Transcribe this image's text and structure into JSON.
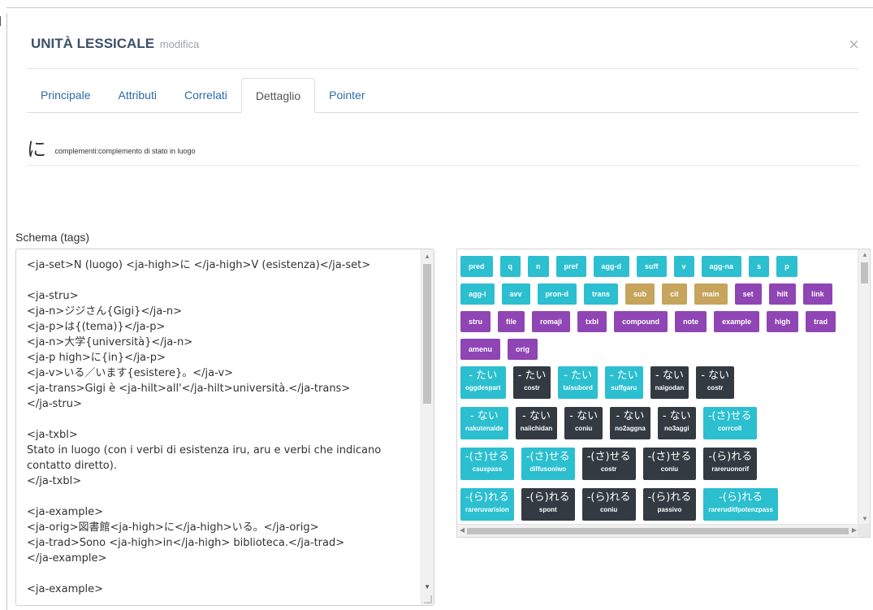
{
  "modal": {
    "title": "UNITÀ LESSICALE",
    "subtitle": "modifica",
    "close": "×"
  },
  "tabs": [
    {
      "label": "Principale"
    },
    {
      "label": "Attributi"
    },
    {
      "label": "Correlati"
    },
    {
      "label": "Dettaglio",
      "active": true
    },
    {
      "label": "Pointer"
    }
  ],
  "detail": {
    "char": "に",
    "description": "complementi:complemento di stato in luogo"
  },
  "schema": {
    "label": "Schema (tags)",
    "lines": [
      "<ja-set>N (luogo) <ja-high>に </ja-high>V (esistenza)</ja-set>",
      "",
      "<ja-stru>",
      "<ja-n>ジジさん{Gigi}</ja-n>",
      "<ja-p>は{(tema)}</ja-p>",
      "<ja-n>大学{università}</ja-n>",
      "<ja-p high>に{in}</ja-p>",
      "<ja-v>いる／います{esistere}。</ja-v>",
      "<ja-trans>Gigi è <ja-hilt>all'</ja-hilt>università.</ja-trans>",
      "</ja-stru>",
      "",
      "<ja-txbl>",
      "Stato in luogo (con i verbi di esistenza iru, aru e verbi che indicano",
      "contatto diretto).",
      "</ja-txbl>",
      "",
      "<ja-example>",
      "<ja-orig>図書館<ja-high>に</ja-high>いる。</ja-orig>",
      "<ja-trad>Sono <ja-high>in</ja-high> biblioteca.</ja-trad>",
      "</ja-example>",
      "",
      "<ja-example>"
    ]
  },
  "tags": {
    "row1": [
      {
        "label": "pred",
        "color": "teal"
      },
      {
        "label": "q",
        "color": "teal"
      },
      {
        "label": "n",
        "color": "teal"
      },
      {
        "label": "pref",
        "color": "teal"
      },
      {
        "label": "agg-d",
        "color": "teal"
      },
      {
        "label": "suff",
        "color": "teal"
      },
      {
        "label": "v",
        "color": "teal"
      },
      {
        "label": "agg-na",
        "color": "teal"
      },
      {
        "label": "s",
        "color": "teal"
      },
      {
        "label": "p",
        "color": "teal"
      }
    ],
    "row2": [
      {
        "label": "agg-i",
        "color": "teal"
      },
      {
        "label": "avv",
        "color": "teal"
      },
      {
        "label": "pron-d",
        "color": "teal"
      },
      {
        "label": "trans",
        "color": "teal"
      },
      {
        "label": "sub",
        "color": "gold"
      },
      {
        "label": "cit",
        "color": "gold"
      },
      {
        "label": "main",
        "color": "gold"
      },
      {
        "label": "set",
        "color": "purple"
      },
      {
        "label": "hilt",
        "color": "purple"
      },
      {
        "label": "link",
        "color": "purple"
      }
    ],
    "row3": [
      {
        "label": "stru",
        "color": "purple"
      },
      {
        "label": "file",
        "color": "purple"
      },
      {
        "label": "romaji",
        "color": "purple"
      },
      {
        "label": "txbl",
        "color": "purple"
      },
      {
        "label": "compound",
        "color": "purple"
      },
      {
        "label": "note",
        "color": "purple"
      },
      {
        "label": "example",
        "color": "purple"
      },
      {
        "label": "high",
        "color": "purple"
      },
      {
        "label": "trad",
        "color": "purple"
      }
    ],
    "row4": [
      {
        "label": "amenu",
        "color": "purple"
      },
      {
        "label": "orig",
        "color": "purple"
      }
    ]
  },
  "forms": {
    "row1": [
      {
        "jp": "- たい",
        "name": "oggdespart",
        "color": "teal"
      },
      {
        "jp": "- たい",
        "name": "costr",
        "color": "dark"
      },
      {
        "jp": "- たい",
        "name": "taisubord",
        "color": "teal"
      },
      {
        "jp": "- たい",
        "name": "suffgaru",
        "color": "teal"
      },
      {
        "jp": "- ない",
        "name": "naigodan",
        "color": "dark"
      },
      {
        "jp": "- ない",
        "name": "costr",
        "color": "dark"
      }
    ],
    "row2": [
      {
        "jp": "- ない",
        "name": "nakutenaide",
        "color": "teal"
      },
      {
        "jp": "- ない",
        "name": "naiichidan",
        "color": "dark"
      },
      {
        "jp": "- ない",
        "name": "coniu",
        "color": "dark"
      },
      {
        "jp": "- ない",
        "name": "no2aggna",
        "color": "dark"
      },
      {
        "jp": "- ない",
        "name": "no3aggi",
        "color": "dark"
      },
      {
        "jp": "-(さ)せる",
        "name": "corrcoll",
        "color": "teal"
      }
    ],
    "row3": [
      {
        "jp": "-(さ)せる",
        "name": "causpass",
        "color": "teal"
      },
      {
        "jp": "-(さ)せる",
        "name": "diffusoniwo",
        "color": "teal"
      },
      {
        "jp": "-(さ)せる",
        "name": "costr",
        "color": "dark"
      },
      {
        "jp": "-(さ)せる",
        "name": "coniu",
        "color": "dark"
      },
      {
        "jp": "-(ら)れる",
        "name": "rareruonorif",
        "color": "dark"
      }
    ],
    "row4": [
      {
        "jp": "-(ら)れる",
        "name": "rareruvarision",
        "color": "teal"
      },
      {
        "jp": "-(ら)れる",
        "name": "spont",
        "color": "dark"
      },
      {
        "jp": "-(ら)れる",
        "name": "coniu",
        "color": "dark"
      },
      {
        "jp": "-(ら)れる",
        "name": "passivo",
        "color": "dark"
      },
      {
        "jp": "-(ら)れる",
        "name": "rareruditfpotenzpass",
        "color": "teal"
      }
    ]
  }
}
